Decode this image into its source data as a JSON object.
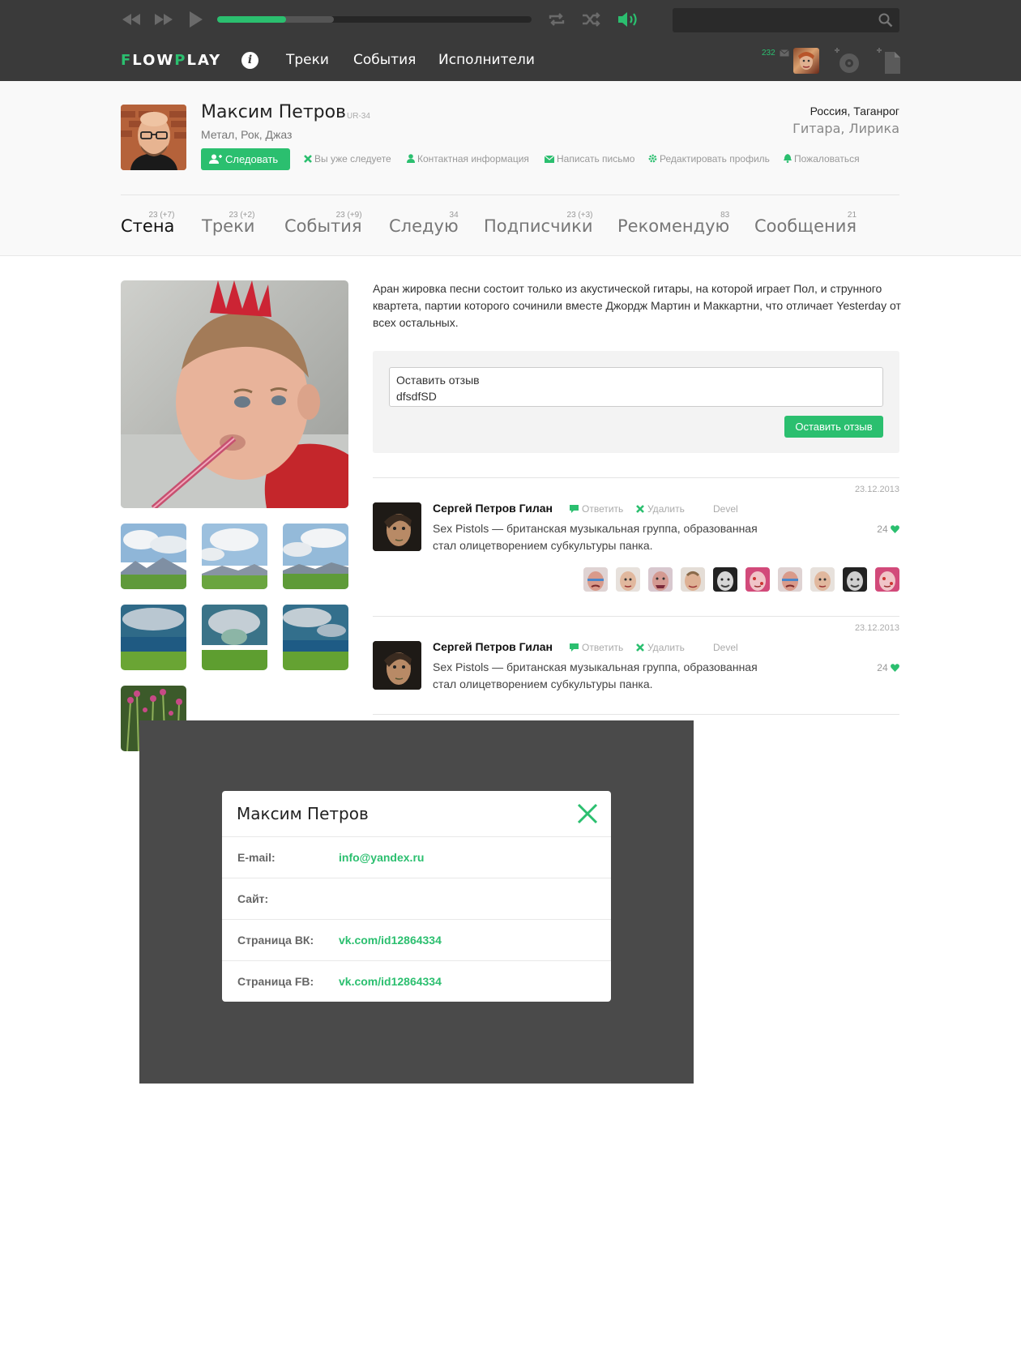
{
  "app": {
    "logo_flow_f": "F",
    "logo_flow_rest": "LOW",
    "logo_play_p": "P",
    "logo_play_rest": "LAY",
    "accent_color": "#2bbf6f"
  },
  "player": {
    "progress_fraction": 0.22,
    "buffer_fraction": 0.37,
    "search_placeholder": ""
  },
  "nav": {
    "info_label": "i",
    "items": [
      "Треки",
      "События",
      "Исполнители"
    ]
  },
  "header_right": {
    "message_count": "232"
  },
  "profile": {
    "name": "Максим Петров",
    "code": "UR-34",
    "genres": "Метал, Рок, Джаз",
    "follow_label": "Следовать",
    "location": "Россия, Таганрог",
    "instruments": "Гитара, Лирика",
    "actions": [
      "Вы уже следуете",
      "Контактная информация",
      "Написать письмо",
      "Редактировать профиль",
      "Пожаловаться"
    ]
  },
  "tabs": [
    {
      "label": "Стена",
      "count": "23 (+7)"
    },
    {
      "label": "Треки",
      "count": "23 (+2)"
    },
    {
      "label": "События",
      "count": "23 (+9)"
    },
    {
      "label": "Следую",
      "count": "34"
    },
    {
      "label": "Подписчики",
      "count": "23 (+3)"
    },
    {
      "label": "Рекомендую",
      "count": "83"
    },
    {
      "label": "Сообщения",
      "count": "21"
    }
  ],
  "wall": {
    "bio": "Аран жировка песни состоит только из акустической гитары, на которой играет Пол, и струнного квартета, партии которого сочинили вместе Джордж Мартин и Маккартни, что отличает Yesterday от всех остальных.",
    "review_line1": "Оставить отзыв",
    "review_line2": "dfsdfSD",
    "review_submit": "Оставить отзыв",
    "comments": [
      {
        "date": "23.12.2013",
        "author": "Сергей Петров Гилан",
        "reply": "Ответить",
        "delete": "Удалить",
        "tag": "Devel",
        "text": "Sex Pistols  — британская музыкальная группа, образованная стал олицетворением субкультуры панка.",
        "likes": "24"
      },
      {
        "date": "23.12.2013",
        "author": "Сергей Петров Гилан",
        "reply": "Ответить",
        "delete": "Удалить",
        "tag": "Devel",
        "text": "Sex Pistols  — британская музыкальная группа, образованная стал олицетворением субкультуры панка.",
        "likes": "24"
      }
    ]
  },
  "modal": {
    "title": "Максим Петров",
    "rows": [
      {
        "label": "E-mail:",
        "value": "info@yandex.ru"
      },
      {
        "label": "Сайт:",
        "value": ""
      },
      {
        "label": "Страница ВК:",
        "value": "vk.com/id12864334"
      },
      {
        "label": "Страница FB:",
        "value": "vk.com/id12864334"
      }
    ]
  }
}
